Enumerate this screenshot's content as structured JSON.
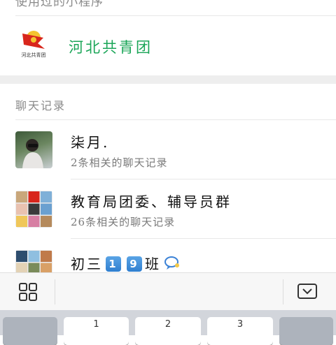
{
  "top_header": "使用过的小程序",
  "mini_program": {
    "name": "河北共青团",
    "logo_caption": "河北共青团"
  },
  "chat_section_label": "聊天记录",
  "chats": [
    {
      "title": "柒月.",
      "subtitle": "2条相关的聊天记录"
    },
    {
      "title": "教育局团委、辅导员群",
      "subtitle": "26条相关的聊天记录"
    },
    {
      "title_prefix": "初三",
      "title_num1": "1",
      "title_num2": "9",
      "title_suffix": "班"
    }
  ],
  "toolbar": {
    "grid_icon": "grid-icon",
    "collapse_icon": "keyboard-collapse-icon"
  },
  "keyboard": {
    "keys": [
      "1",
      "2",
      "3"
    ]
  },
  "colors": {
    "mini_program_green": "#1aa557",
    "emoji_blue": "#2f7fd0",
    "logo_red": "#d8261c"
  }
}
